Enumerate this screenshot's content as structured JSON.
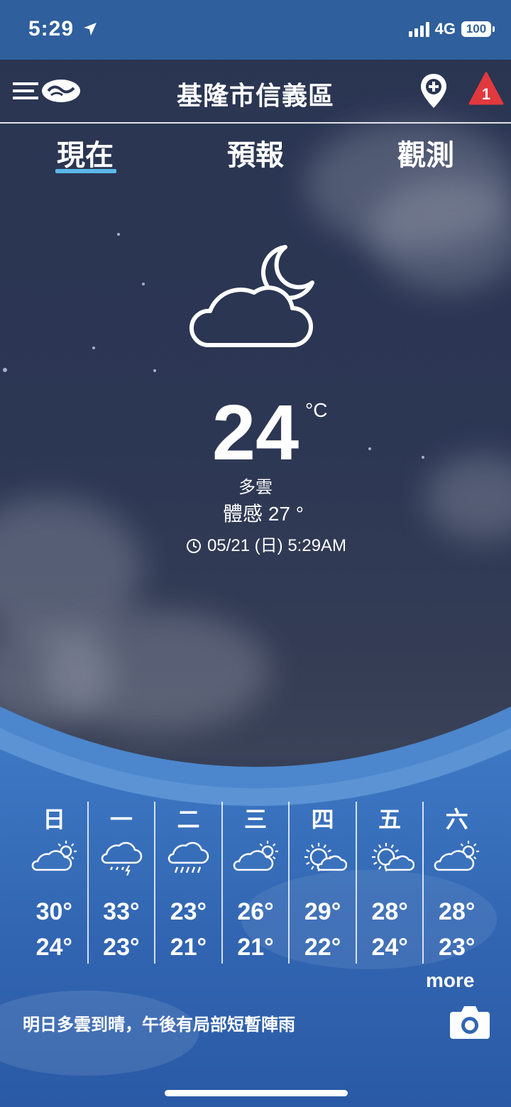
{
  "status_bar": {
    "time": "5:29",
    "network": "4G",
    "battery": "100"
  },
  "header": {
    "city": "基隆市信義區",
    "alert_count": "1"
  },
  "tabs": [
    {
      "label": "現在"
    },
    {
      "label": "預報"
    },
    {
      "label": "觀測"
    }
  ],
  "current": {
    "icon": "cloudy-night-icon",
    "temperature": "24",
    "unit": "°C",
    "description": "多雲",
    "feels_like": "體感 27 °",
    "updated": "05/21 (日) 5:29AM"
  },
  "forecast": [
    {
      "day": "日",
      "icon": "partly-cloudy-icon",
      "high": "30°",
      "low": "24°"
    },
    {
      "day": "一",
      "icon": "thunderstorm-icon",
      "high": "33°",
      "low": "23°"
    },
    {
      "day": "二",
      "icon": "rain-icon",
      "high": "23°",
      "low": "21°"
    },
    {
      "day": "三",
      "icon": "partly-cloudy-icon",
      "high": "26°",
      "low": "21°"
    },
    {
      "day": "四",
      "icon": "sunny-cloudy-icon",
      "high": "29°",
      "low": "22°"
    },
    {
      "day": "五",
      "icon": "sunny-cloudy-icon",
      "high": "28°",
      "low": "24°"
    },
    {
      "day": "六",
      "icon": "partly-cloudy-icon",
      "high": "28°",
      "low": "23°"
    }
  ],
  "more_label": "more",
  "summary": "明日多雲到晴，午後有局部短暫陣雨",
  "colors": {
    "status_bar": "#2f5f9c",
    "tab_indicator": "#5ab8e8",
    "alert": "#e0393e",
    "panel": "#3b74bf"
  }
}
